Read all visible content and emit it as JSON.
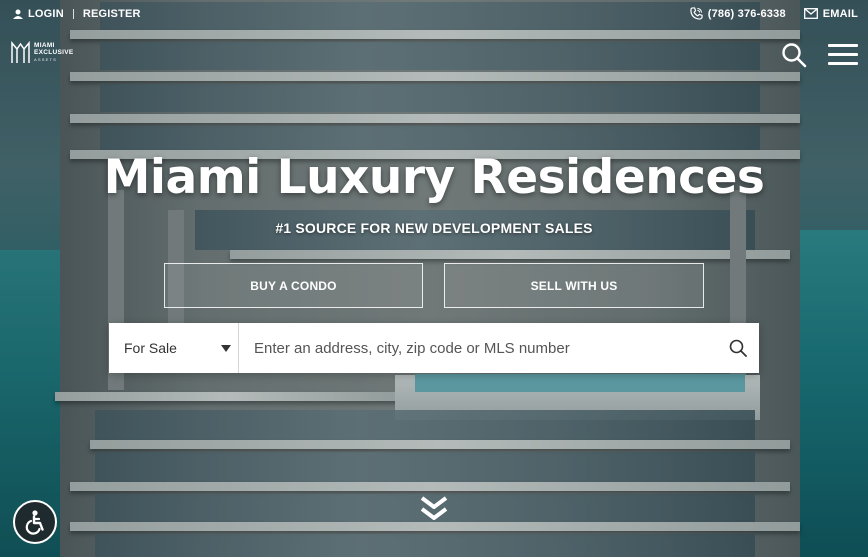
{
  "topbar": {
    "login_label": "LOGIN",
    "register_label": "REGISTER",
    "phone_label": "(786) 376-6338",
    "email_label": "EMAIL"
  },
  "logo": {
    "line1": "MIAMI",
    "line2": "EXCLUSIVE",
    "line3": "ASSETS"
  },
  "hero": {
    "title": "Miami Luxury Residences",
    "subtitle": "#1 SOURCE FOR NEW DEVELOPMENT SALES",
    "buy_label": "BUY A CONDO",
    "sell_label": "SELL WITH US"
  },
  "search": {
    "type_selected": "For Sale",
    "placeholder": "Enter an address, city, zip code or MLS number"
  },
  "icons": {
    "user": "user-icon",
    "phone": "phone-icon",
    "email": "envelope-icon",
    "search": "search-icon",
    "menu": "hamburger-menu-icon",
    "accessibility": "accessibility-icon",
    "scroll": "chevron-double-down-icon"
  },
  "colors": {
    "text": "#ffffff",
    "search_bg": "#ffffff",
    "search_text": "#333333",
    "accessibility_bg": "#1f2a2e"
  }
}
